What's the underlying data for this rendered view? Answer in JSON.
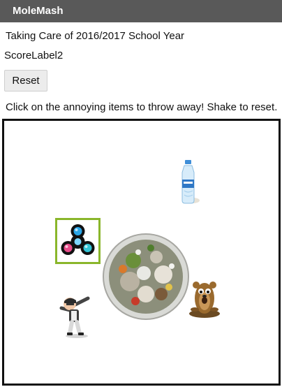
{
  "app": {
    "title": "MoleMash"
  },
  "header_label": "Taking Care of 2016/2017 School Year",
  "score_label": "ScoreLabel2",
  "reset_button": {
    "label": "Reset"
  },
  "instructions": "Click on the annoying items to throw away! Shake to reset.",
  "canvas": {
    "sprites": [
      "water-bottle",
      "fidget-spinner",
      "trash-bowl",
      "dabbing-character",
      "mole"
    ]
  },
  "colors": {
    "titlebar": "#595959",
    "spinner_highlight": "#8ab62b",
    "canvas_border": "#111111"
  }
}
